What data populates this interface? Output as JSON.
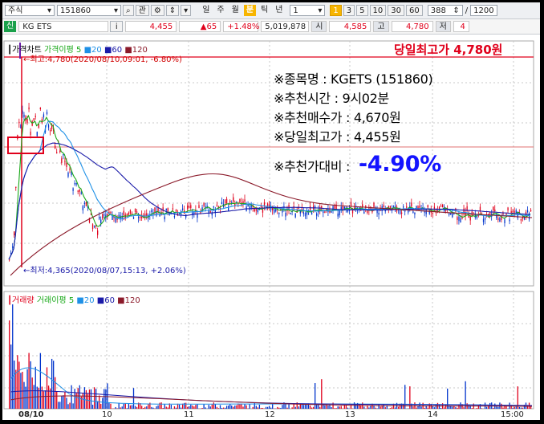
{
  "toolbar": {
    "market": "주식",
    "code": "151860",
    "btn_kwan": "관",
    "periods": [
      {
        "label": "일",
        "active": false
      },
      {
        "label": "주",
        "active": false
      },
      {
        "label": "월",
        "active": false
      },
      {
        "label": "분",
        "active": true
      },
      {
        "label": "틱",
        "active": false
      },
      {
        "label": "년",
        "active": false
      }
    ],
    "interval_value": "1",
    "minute_choices": [
      {
        "label": "1",
        "active": true
      },
      {
        "label": "3",
        "active": false
      },
      {
        "label": "5",
        "active": false
      },
      {
        "label": "10",
        "active": false
      },
      {
        "label": "30",
        "active": false
      },
      {
        "label": "60",
        "active": false
      }
    ],
    "count_value": "388",
    "slash": "/",
    "total_value": "1200"
  },
  "quote": {
    "tag": "신",
    "name": "KG ETS",
    "info_icon": "i",
    "price": "4,455",
    "change": "▲65",
    "change_pct": "+1.48%",
    "volume": "5,019,878",
    "open_label": "시",
    "open_value": "4,585",
    "high_label": "고",
    "high_value": "4,780",
    "low_label": "저",
    "low_value": "4"
  },
  "colors": {
    "up": "#e0001b",
    "down": "#0033cc",
    "ma5": "#18a818",
    "ma20": "#1e90e6",
    "ma60": "#1a1aa8",
    "ma120": "#8b1a2a",
    "accent": "#f7b500"
  },
  "price_chart": {
    "legend": {
      "title": "가격차트",
      "ma_label": "가격이평",
      "ma": [
        "5",
        "20",
        "60",
        "120"
      ]
    },
    "high_note": "←최고:4,780(2020/08/10,09:01, -6.80%)",
    "low_note": "←최저:4,365(2020/08/07,15:13, +2.06%)",
    "headline": "당일최고가 4,780원"
  },
  "recommendation": {
    "stock": "※종목명 : KGETS (151860)",
    "time": "※추천시간 : 9시02분",
    "buy": "※추천매수가 : 4,670원",
    "high": "※당일최고가 : 4,455원",
    "ratio_label": "※추천가대비 :",
    "ratio_value": "-4.90%"
  },
  "volume_chart": {
    "legend": {
      "title": "거래량",
      "ma_label": "거래이평",
      "ma": [
        "5",
        "20",
        "60",
        "120"
      ]
    }
  },
  "xaxis": {
    "labels": [
      "08/10",
      "10",
      "11",
      "12",
      "13",
      "14",
      "15:00"
    ]
  }
}
